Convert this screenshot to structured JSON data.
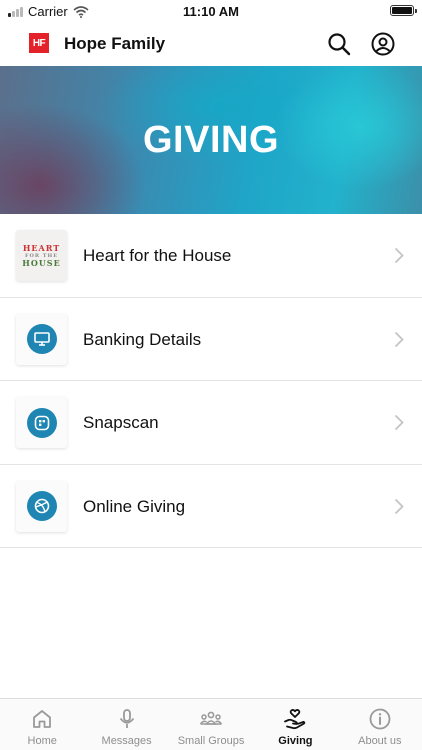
{
  "status_bar": {
    "carrier": "Carrier",
    "time": "11:10 AM"
  },
  "header": {
    "logo_text": "HF",
    "title": "Hope Family"
  },
  "banner": {
    "title": "GIVING"
  },
  "list": {
    "items": [
      {
        "label": "Heart for the House",
        "thumb_top": "HEART",
        "thumb_mid": "FOR THE",
        "thumb_bot": "HOUSE"
      },
      {
        "label": "Banking Details",
        "icon": "monitor-icon"
      },
      {
        "label": "Snapscan",
        "icon": "snapscan-icon"
      },
      {
        "label": "Online Giving",
        "icon": "globe-icon"
      }
    ]
  },
  "tabs": [
    {
      "label": "Home",
      "icon": "home-icon",
      "active": false
    },
    {
      "label": "Messages",
      "icon": "microphone-icon",
      "active": false
    },
    {
      "label": "Small Groups",
      "icon": "group-icon",
      "active": false
    },
    {
      "label": "Giving",
      "icon": "hand-heart-icon",
      "active": true
    },
    {
      "label": "About us",
      "icon": "info-icon",
      "active": false
    }
  ],
  "colors": {
    "brand_red": "#e32229",
    "icon_blue": "#1f86b3",
    "active_tab": "#111111",
    "inactive_tab": "#8e8e8e"
  }
}
